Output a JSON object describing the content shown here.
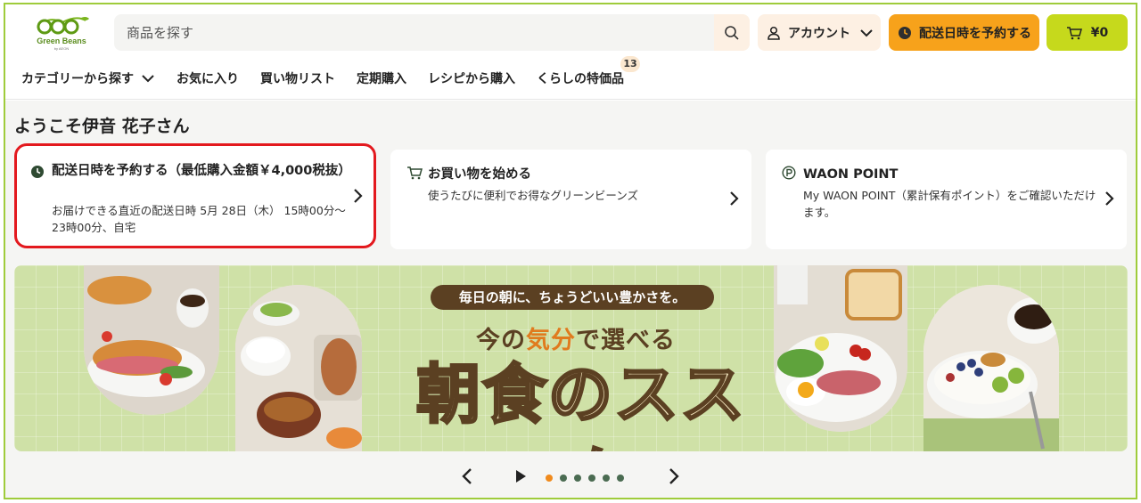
{
  "brand": {
    "name": "Green Beans",
    "sub": "by AEON",
    "colors": {
      "green": "#9fcc3b",
      "orange": "#f7a21b",
      "lime": "#c6d91c",
      "peach": "#fdf0e3",
      "brown": "#5b4022"
    }
  },
  "header": {
    "search_placeholder": "商品を探す",
    "account_label": "アカウント",
    "reserve_label": "配送日時を予約する",
    "cart_label": "¥0"
  },
  "nav": {
    "items": [
      {
        "label": "カテゴリーから探す",
        "has_dropdown": true
      },
      {
        "label": "お気に入り"
      },
      {
        "label": "買い物リスト"
      },
      {
        "label": "定期購入"
      },
      {
        "label": "レシピから購入"
      },
      {
        "label": "くらしの特価品",
        "badge": "13"
      }
    ]
  },
  "main": {
    "welcome": "ようこそ伊音 花子さん",
    "cards": [
      {
        "icon": "clock-icon",
        "title": "配送日時を予約する（最低購入金額￥4,000税抜）",
        "desc": "お届けできる直近の配送日時 5月 28日（木） 15時00分～23時00分、自宅",
        "highlighted": true
      },
      {
        "icon": "cart-icon",
        "title": "お買い物を始める",
        "desc": "使うたびに便利でお得なグリーンビーンズ"
      },
      {
        "icon": "point-icon",
        "title": "WAON POINT",
        "desc": "My WAON POINT（累計保有ポイント）をご確認いただけます。"
      }
    ],
    "banner": {
      "pill": "毎日の朝に、ちょうどいい豊かさを。",
      "sub_pre": "今の",
      "sub_hl": "気分",
      "sub_post": "で選べる",
      "headline": "朝食のススメ"
    },
    "carousel": {
      "slide_count": 6,
      "active_index": 0
    }
  }
}
